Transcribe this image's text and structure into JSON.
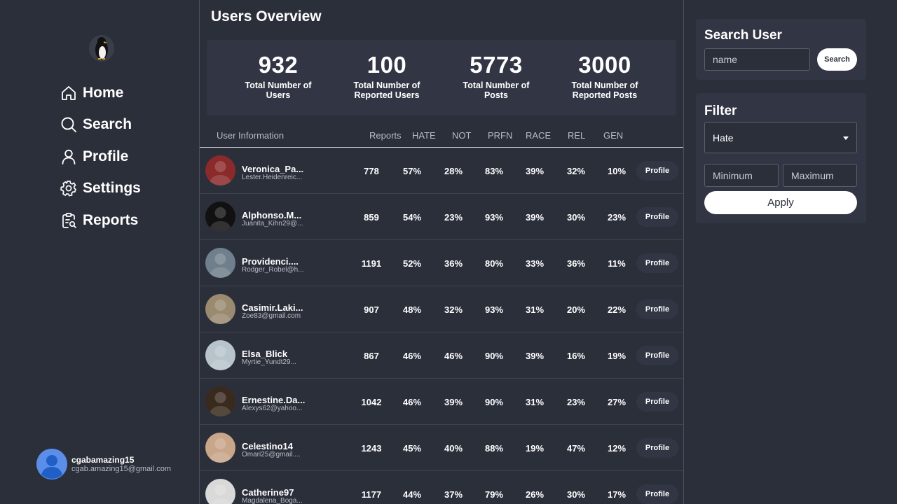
{
  "sidebar": {
    "nav": [
      {
        "label": "Home",
        "icon": "home-icon"
      },
      {
        "label": "Search",
        "icon": "search-icon"
      },
      {
        "label": "Profile",
        "icon": "user-icon"
      },
      {
        "label": "Settings",
        "icon": "gear-icon"
      },
      {
        "label": "Reports",
        "icon": "clipboard-search-icon"
      }
    ],
    "account": {
      "username": "cgabamazing15",
      "email": "cgab.amazing15@gmail.com"
    }
  },
  "main": {
    "title": "Users Overview",
    "stats": [
      {
        "value": "932",
        "label_line1": "Total Number of",
        "label_line2": "Users"
      },
      {
        "value": "100",
        "label_line1": "Total Number of",
        "label_line2": "Reported Users"
      },
      {
        "value": "5773",
        "label_line1": "Total Number of",
        "label_line2": "Posts"
      },
      {
        "value": "3000",
        "label_line1": "Total Number of",
        "label_line2": "Reported Posts"
      }
    ],
    "table": {
      "headers": {
        "user_info": "User Information",
        "reports": "Reports",
        "hate": "HATE",
        "not": "NOT",
        "prfn": "PRFN",
        "race": "RACE",
        "rel": "REL",
        "gen": "GEN"
      },
      "profile_label": "Profile",
      "rows": [
        {
          "name": "Veronica_Pa...",
          "email": "Lester.Heidenreic...",
          "reports": "778",
          "hate": "57%",
          "not": "28%",
          "prfn": "83%",
          "race": "39%",
          "rel": "32%",
          "gen": "10%",
          "avatar_color": "#8b2a2a"
        },
        {
          "name": "Alphonso.M...",
          "email": "Juanita_Kihn29@...",
          "reports": "859",
          "hate": "54%",
          "not": "23%",
          "prfn": "93%",
          "race": "39%",
          "rel": "30%",
          "gen": "23%",
          "avatar_color": "#111111"
        },
        {
          "name": "Providenci....",
          "email": "Rodger_Robel@h...",
          "reports": "1191",
          "hate": "52%",
          "not": "36%",
          "prfn": "80%",
          "race": "33%",
          "rel": "36%",
          "gen": "11%",
          "avatar_color": "#6f7f8c"
        },
        {
          "name": "Casimir.Laki...",
          "email": "Zoe83@gmail.com",
          "reports": "907",
          "hate": "48%",
          "not": "32%",
          "prfn": "93%",
          "race": "31%",
          "rel": "20%",
          "gen": "22%",
          "avatar_color": "#9a8a70"
        },
        {
          "name": "Elsa_Blick",
          "email": "Myrtie_Yundt29...",
          "reports": "867",
          "hate": "46%",
          "not": "46%",
          "prfn": "90%",
          "race": "39%",
          "rel": "16%",
          "gen": "19%",
          "avatar_color": "#b8c4cc"
        },
        {
          "name": "Ernestine.Da...",
          "email": "Alexys62@yahoo...",
          "reports": "1042",
          "hate": "46%",
          "not": "39%",
          "prfn": "90%",
          "race": "31%",
          "rel": "23%",
          "gen": "27%",
          "avatar_color": "#3a2a1e"
        },
        {
          "name": "Celestino14",
          "email": "Omari25@gmail....",
          "reports": "1243",
          "hate": "45%",
          "not": "40%",
          "prfn": "88%",
          "race": "19%",
          "rel": "47%",
          "gen": "12%",
          "avatar_color": "#c9a58a"
        },
        {
          "name": "Catherine97",
          "email": "Magdalena_Boga...",
          "reports": "1177",
          "hate": "44%",
          "not": "37%",
          "prfn": "79%",
          "race": "26%",
          "rel": "30%",
          "gen": "17%",
          "avatar_color": "#d9d9d9"
        }
      ]
    }
  },
  "search_panel": {
    "title": "Search User",
    "placeholder": "name",
    "button": "Search"
  },
  "filter_panel": {
    "title": "Filter",
    "selected": "Hate",
    "min_placeholder": "Minimum",
    "max_placeholder": "Maximum",
    "apply": "Apply"
  },
  "colors": {
    "background": "#2b2f3a",
    "card": "#323644",
    "text": "#ffffff",
    "muted": "#b9bcc6"
  }
}
